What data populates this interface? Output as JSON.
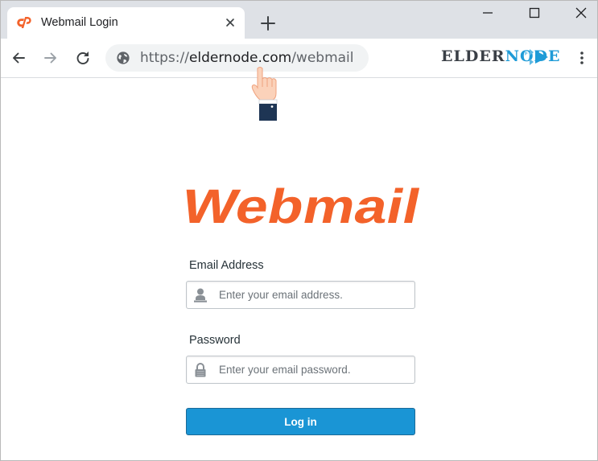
{
  "browser": {
    "tab": {
      "title": "Webmail Login",
      "favicon": "cpanel-icon"
    },
    "url": {
      "scheme": "https://",
      "host": "eldernode.com",
      "path": "/webmail"
    },
    "brand": {
      "part1": "ELDER",
      "part2": "NODE"
    }
  },
  "page": {
    "logo_text": "Webmail",
    "email": {
      "label": "Email Address",
      "placeholder": "Enter your email address.",
      "value": ""
    },
    "password": {
      "label": "Password",
      "placeholder": "Enter your email password.",
      "value": ""
    },
    "login_label": "Log in"
  },
  "colors": {
    "accent_orange": "#f3622a",
    "button_blue": "#1a95d5",
    "brand_blue": "#1f9bd7",
    "tabstrip_gray": "#dee1e6"
  }
}
